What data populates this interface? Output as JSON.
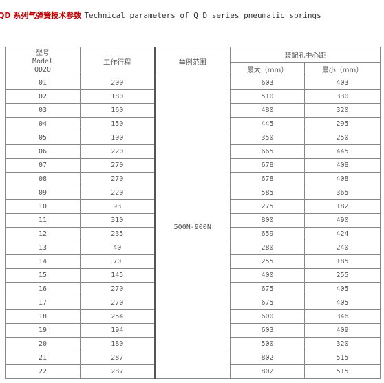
{
  "title": {
    "cn": "QD 系列气弹簧技术参数",
    "en": "Technical parameters of Q D series pneumatic springs"
  },
  "table": {
    "headers": {
      "model_cn": "型号",
      "model_en": "Model",
      "model_code": "QD20",
      "stroke": "工作行程",
      "force_range": "举例范围",
      "center_distance": "装配孔中心距",
      "max": "最大（mm）",
      "min": "最小（mm）"
    },
    "force_range_value": "500N-900N",
    "rows": [
      [
        "01",
        "200",
        "603",
        "403"
      ],
      [
        "02",
        "180",
        "510",
        "330"
      ],
      [
        "03",
        "160",
        "480",
        "320"
      ],
      [
        "04",
        "150",
        "445",
        "295"
      ],
      [
        "05",
        "100",
        "350",
        "250"
      ],
      [
        "06",
        "220",
        "665",
        "445"
      ],
      [
        "07",
        "270",
        "678",
        "408"
      ],
      [
        "08",
        "270",
        "678",
        "408"
      ],
      [
        "09",
        "220",
        "585",
        "365"
      ],
      [
        "10",
        "93",
        "275",
        "182"
      ],
      [
        "11",
        "310",
        "800",
        "490"
      ],
      [
        "12",
        "235",
        "659",
        "424"
      ],
      [
        "13",
        "40",
        "280",
        "240"
      ],
      [
        "14",
        "70",
        "255",
        "185"
      ],
      [
        "15",
        "145",
        "400",
        "255"
      ],
      [
        "16",
        "270",
        "675",
        "405"
      ],
      [
        "17",
        "270",
        "675",
        "405"
      ],
      [
        "18",
        "254",
        "600",
        "346"
      ],
      [
        "19",
        "194",
        "603",
        "409"
      ],
      [
        "20",
        "180",
        "500",
        "320"
      ],
      [
        "21",
        "287",
        "802",
        "515"
      ],
      [
        "22",
        "287",
        "802",
        "515"
      ]
    ]
  }
}
